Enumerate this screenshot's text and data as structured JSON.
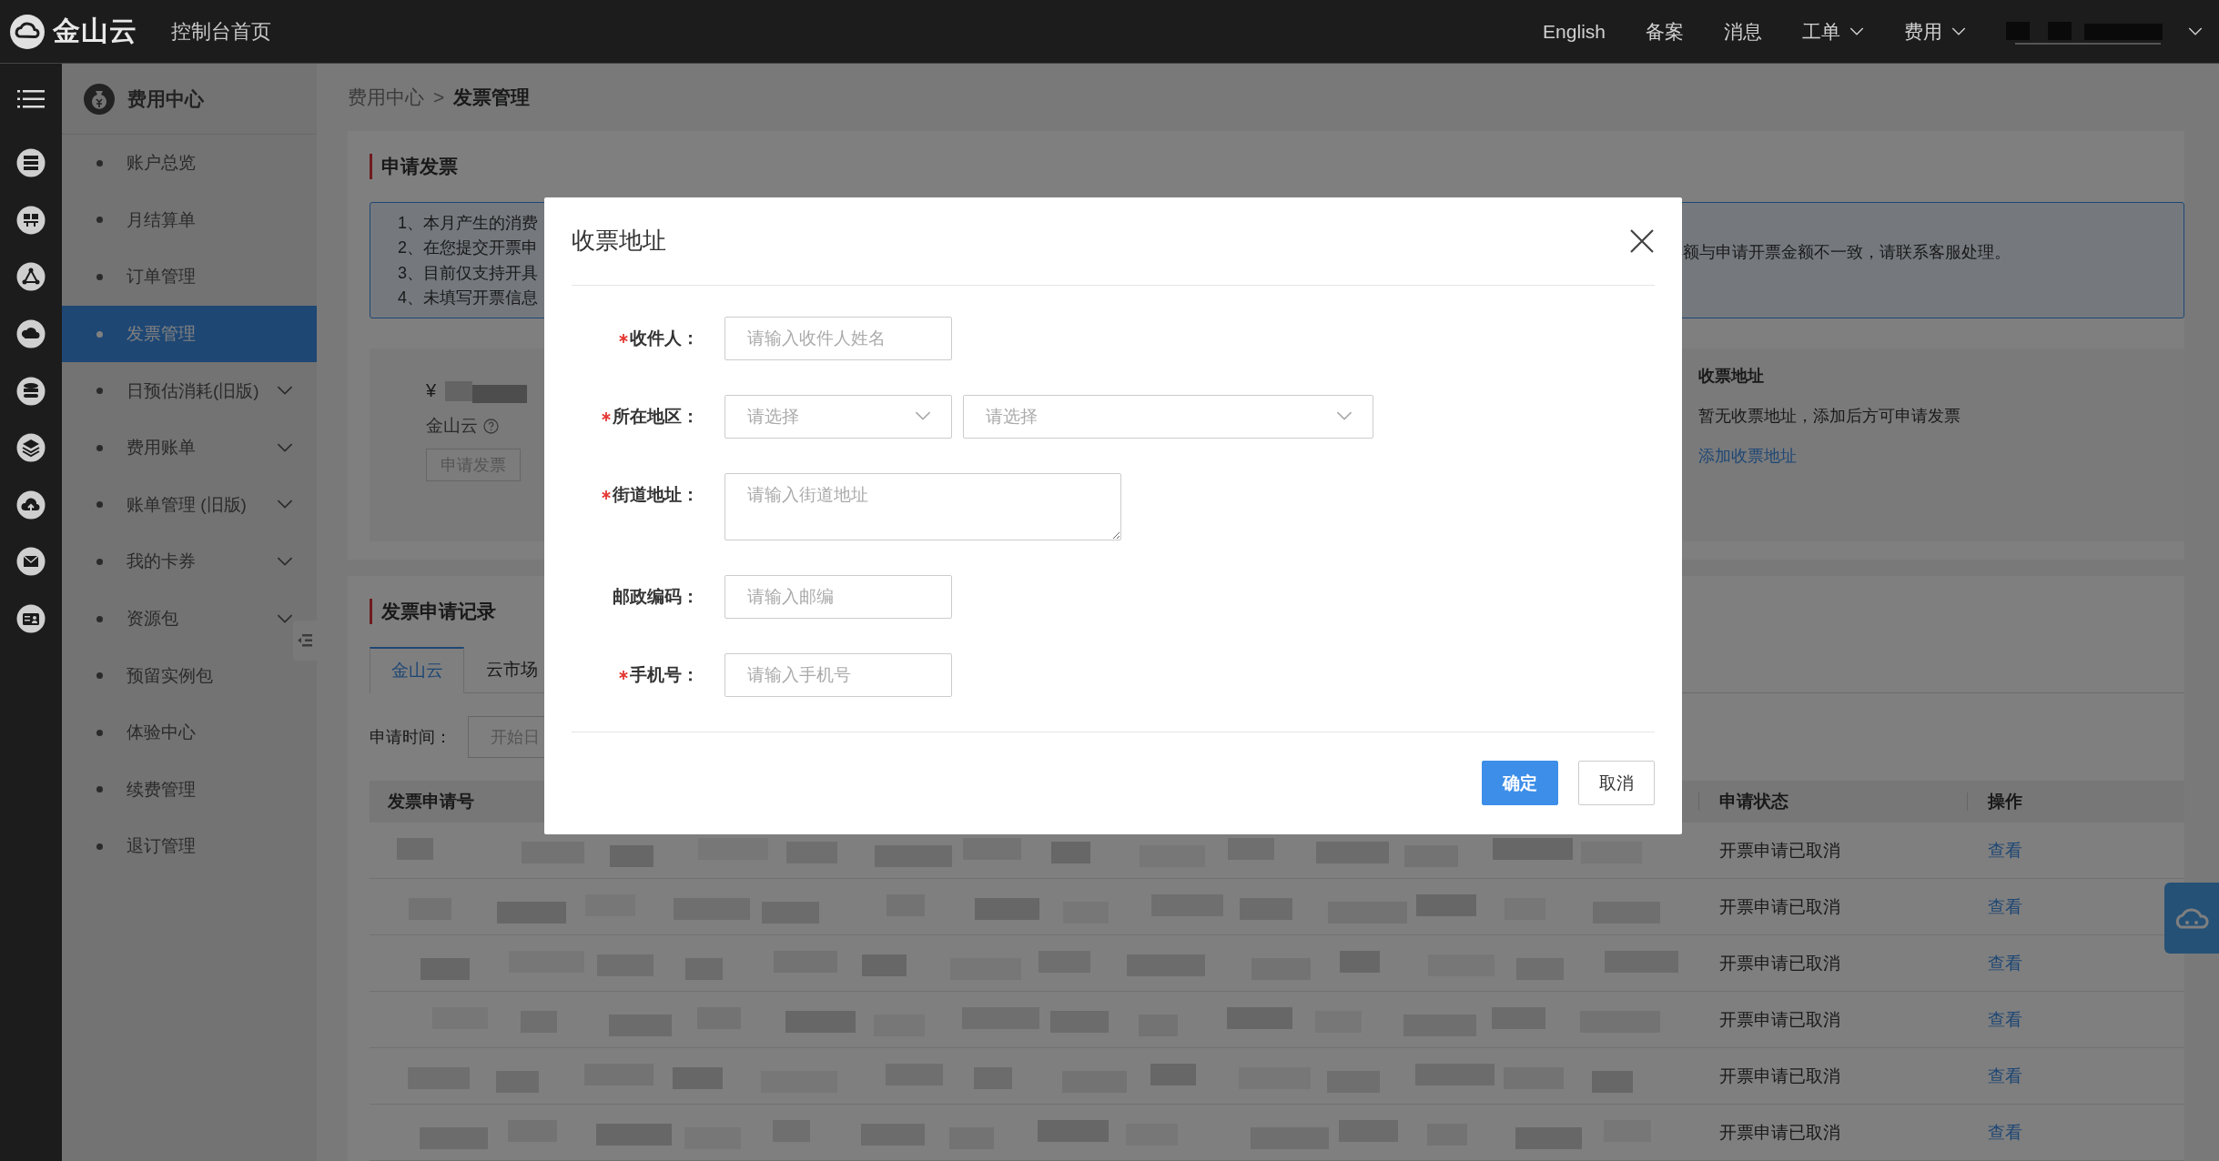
{
  "top_bar": {
    "logo": "金山云",
    "home": "控制台首页",
    "links": [
      {
        "label": "English",
        "dropdown": false
      },
      {
        "label": "备案",
        "dropdown": false
      },
      {
        "label": "消息",
        "dropdown": false
      },
      {
        "label": "工单",
        "dropdown": true
      },
      {
        "label": "费用",
        "dropdown": true
      }
    ]
  },
  "sidebar": {
    "title": "费用中心",
    "items": [
      {
        "label": "账户总览",
        "selected": false,
        "expandable": false
      },
      {
        "label": "月结算单",
        "selected": false,
        "expandable": false
      },
      {
        "label": "订单管理",
        "selected": false,
        "expandable": false
      },
      {
        "label": "发票管理",
        "selected": true,
        "expandable": false
      },
      {
        "label": "日预估消耗(旧版)",
        "selected": false,
        "expandable": true
      },
      {
        "label": "费用账单",
        "selected": false,
        "expandable": true
      },
      {
        "label": "账单管理 (旧版)",
        "selected": false,
        "expandable": true
      },
      {
        "label": "我的卡券",
        "selected": false,
        "expandable": true
      },
      {
        "label": "资源包",
        "selected": false,
        "expandable": true
      },
      {
        "label": "预留实例包",
        "selected": false,
        "expandable": false
      },
      {
        "label": "体验中心",
        "selected": false,
        "expandable": false
      },
      {
        "label": "续费管理",
        "selected": false,
        "expandable": false
      },
      {
        "label": "退订管理",
        "selected": false,
        "expandable": false
      }
    ]
  },
  "breadcrumb": {
    "items": [
      "费用中心",
      "发票管理"
    ],
    "separator": ">"
  },
  "apply_section": {
    "title": "申请发票",
    "notice_lines": [
      "1、本月产生的消费",
      "2、在您提交开票申",
      "3、目前仅支持开具",
      "4、未填写开票信息"
    ],
    "notice_tail": "额与申请开票金额不一致，请联系客服处理。",
    "currency": "¥",
    "account": "金山云",
    "apply_button": {
      "label": "申请发票",
      "disabled": true
    },
    "address": {
      "title": "收票地址",
      "empty_text": "暂无收票地址，添加后方可申请发票",
      "link": "添加收票地址"
    }
  },
  "records_section": {
    "title": "发票申请记录",
    "tabs": [
      {
        "label": "金山云",
        "selected": true
      },
      {
        "label": "云市场",
        "selected": false
      }
    ],
    "filter_label": "申请时间：",
    "date_placeholder": "开始日",
    "columns": [
      "发票申请号",
      "申请状态",
      "操作"
    ],
    "rows": [
      {
        "status": "开票申请已取消",
        "action": "查看"
      },
      {
        "status": "开票申请已取消",
        "action": "查看"
      },
      {
        "status": "开票申请已取消",
        "action": "查看"
      },
      {
        "status": "开票申请已取消",
        "action": "查看"
      },
      {
        "status": "开票申请已取消",
        "action": "查看"
      },
      {
        "status": "开票申请已取消",
        "action": "查看"
      }
    ]
  },
  "dialog": {
    "title": "收票地址",
    "fields": [
      {
        "kind": "input",
        "label": "收件人：",
        "required": true,
        "placeholder": "请输入收件人姓名"
      },
      {
        "kind": "select",
        "label": "所在地区：",
        "required": true,
        "selects": [
          {
            "placeholder": "请选择"
          },
          {
            "placeholder": "请选择"
          }
        ]
      },
      {
        "kind": "textarea",
        "label": "街道地址：",
        "required": true,
        "placeholder": "请输入街道地址"
      },
      {
        "kind": "input",
        "label": "邮政编码：",
        "required": false,
        "placeholder": "请输入邮编"
      },
      {
        "kind": "input",
        "label": "手机号：",
        "required": true,
        "placeholder": "请输入手机号"
      }
    ],
    "buttons": [
      {
        "label": "确定",
        "primary": true
      },
      {
        "label": "取消",
        "primary": false
      }
    ]
  }
}
